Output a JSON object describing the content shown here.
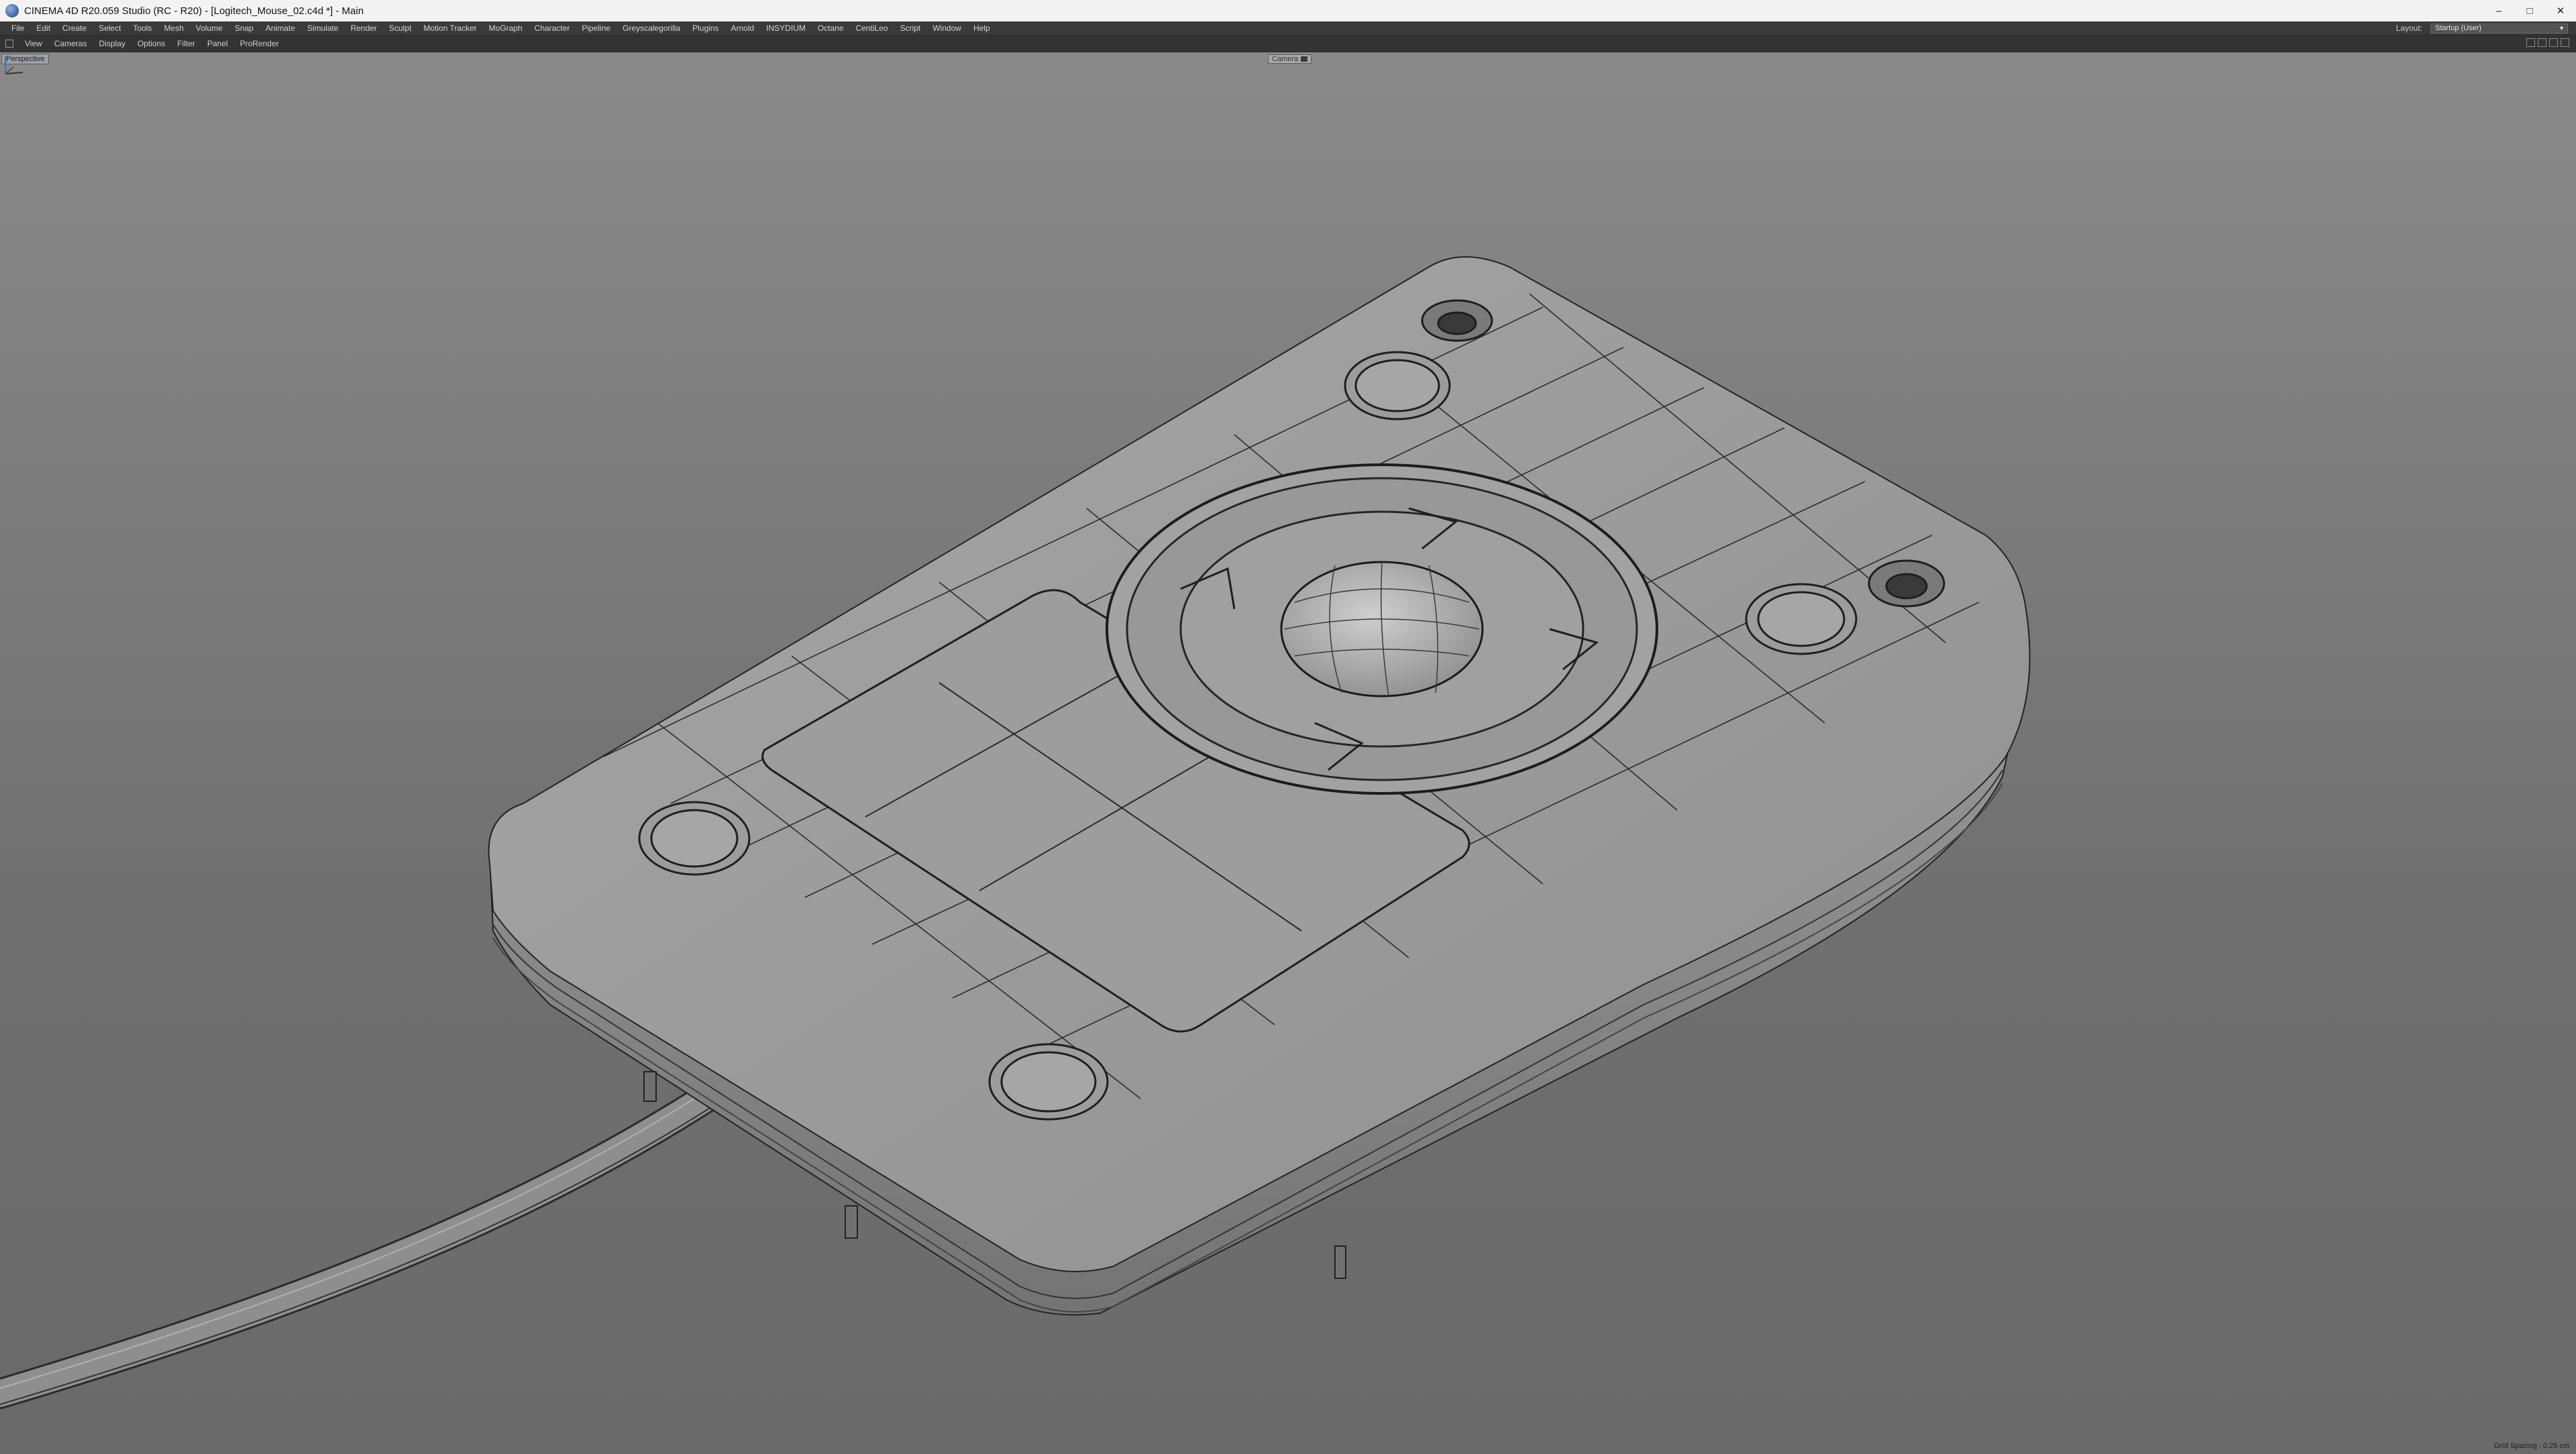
{
  "window": {
    "title": "CINEMA 4D R20.059 Studio (RC - R20) - [Logitech_Mouse_02.c4d *] - Main",
    "controls": {
      "minimize": "–",
      "maximize": "□",
      "close": "✕"
    }
  },
  "main_menu": [
    "File",
    "Edit",
    "Create",
    "Select",
    "Tools",
    "Mesh",
    "Volume",
    "Snap",
    "Animate",
    "Simulate",
    "Render",
    "Sculpt",
    "Motion Tracker",
    "MoGraph",
    "Character",
    "Pipeline",
    "Greyscalegorilla",
    "Plugins",
    "Arnold",
    "INSYDIUM",
    "Octane",
    "CentiLeo",
    "Script",
    "Window",
    "Help"
  ],
  "layout": {
    "label": "Layout:",
    "value": "Startup (User)"
  },
  "view_menu": [
    "View",
    "Cameras",
    "Display",
    "Options",
    "Filter",
    "Panel",
    "ProRender"
  ],
  "viewport": {
    "projection_label": "Perspective",
    "camera_tag": "Camera",
    "grid_spacing": "Grid Spacing : 0.25 cm",
    "background_top": "#8a8a8a",
    "background_bottom": "#6a6a6a",
    "mesh_color": "#222222"
  },
  "icons": {
    "app": "cinema4d-logo-icon",
    "view_menu": "view-menu-icon",
    "nav": [
      "move-view-icon",
      "zoom-view-icon",
      "rotate-view-icon",
      "maximize-view-icon"
    ]
  }
}
